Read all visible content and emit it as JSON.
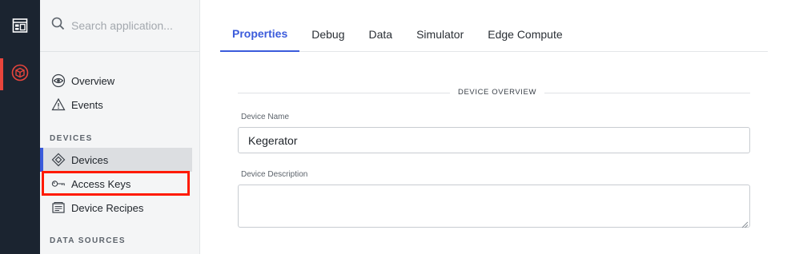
{
  "sidebar": {
    "search_placeholder": "Search application...",
    "items": [
      {
        "label": "Overview",
        "icon": "eye-icon"
      },
      {
        "label": "Events",
        "icon": "warning-icon"
      }
    ],
    "sections": [
      {
        "label": "DEVICES"
      },
      {
        "label": "DATA SOURCES"
      }
    ],
    "device_items": [
      {
        "label": "Devices",
        "icon": "diamond-icon",
        "active": true
      },
      {
        "label": "Access Keys",
        "icon": "key-icon",
        "active": false
      },
      {
        "label": "Device Recipes",
        "icon": "recipe-icon",
        "active": false
      }
    ]
  },
  "tabs": [
    {
      "label": "Properties",
      "active": true
    },
    {
      "label": "Debug",
      "active": false
    },
    {
      "label": "Data",
      "active": false
    },
    {
      "label": "Simulator",
      "active": false
    },
    {
      "label": "Edge Compute",
      "active": false
    }
  ],
  "form": {
    "section_title": "DEVICE OVERVIEW",
    "device_name_label": "Device Name",
    "device_name_value": "Kegerator",
    "device_description_label": "Device Description",
    "device_description_value": ""
  },
  "colors": {
    "rail": "#1b2430",
    "accent": "#3b5bdb",
    "rail_active": "#e8453c",
    "highlight": "#ff1a00"
  }
}
